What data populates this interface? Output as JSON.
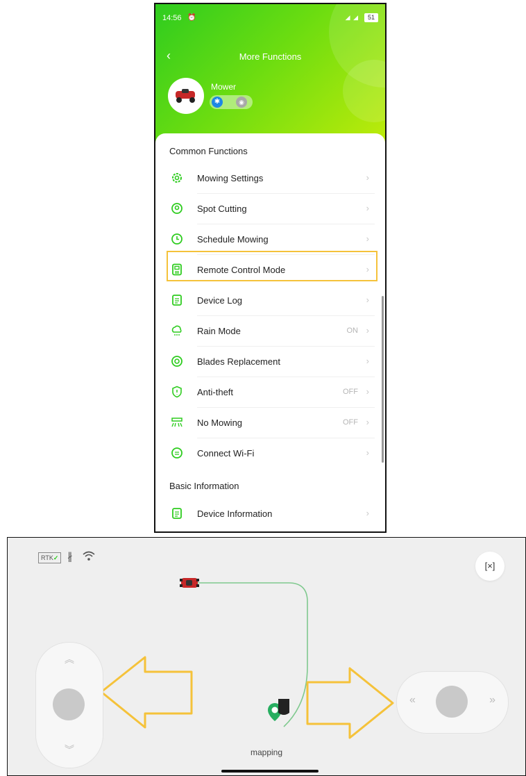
{
  "phone": {
    "status_bar": {
      "time": "14:56",
      "battery": "51"
    },
    "nav": {
      "title": "More Functions"
    },
    "device": {
      "name": "Mower"
    },
    "sections": [
      {
        "title": "Common Functions"
      },
      {
        "title": "Basic Information"
      }
    ],
    "items": [
      {
        "label": "Mowing Settings",
        "value": "",
        "icon": "gear-icon"
      },
      {
        "label": "Spot Cutting",
        "value": "",
        "icon": "location-pin-icon"
      },
      {
        "label": "Schedule Mowing",
        "value": "",
        "icon": "clock-icon"
      },
      {
        "label": "Remote Control Mode",
        "value": "",
        "icon": "remote-icon"
      },
      {
        "label": "Device Log",
        "value": "",
        "icon": "log-icon"
      },
      {
        "label": "Rain Mode",
        "value": "ON",
        "icon": "rain-cloud-icon"
      },
      {
        "label": "Blades Replacement",
        "value": "",
        "icon": "blade-icon"
      },
      {
        "label": "Anti-theft",
        "value": "OFF",
        "icon": "shield-icon"
      },
      {
        "label": "No Mowing",
        "value": "OFF",
        "icon": "no-mowing-icon"
      },
      {
        "label": "Connect Wi-Fi",
        "value": "",
        "icon": "wifi-icon"
      },
      {
        "label": "Device Information",
        "value": "",
        "icon": "info-doc-icon"
      }
    ],
    "colors": {
      "accent": "#2ecc1f",
      "gradient_end": "#c4ec0a",
      "highlight": "#f5c23a",
      "bluetooth": "#1e88e5"
    }
  },
  "remote": {
    "rtk_label": "RTK",
    "status_text": "mapping",
    "colors": {
      "path": "#7fc98e",
      "arrow": "#f5c23a",
      "pin": "#27ae60"
    }
  }
}
